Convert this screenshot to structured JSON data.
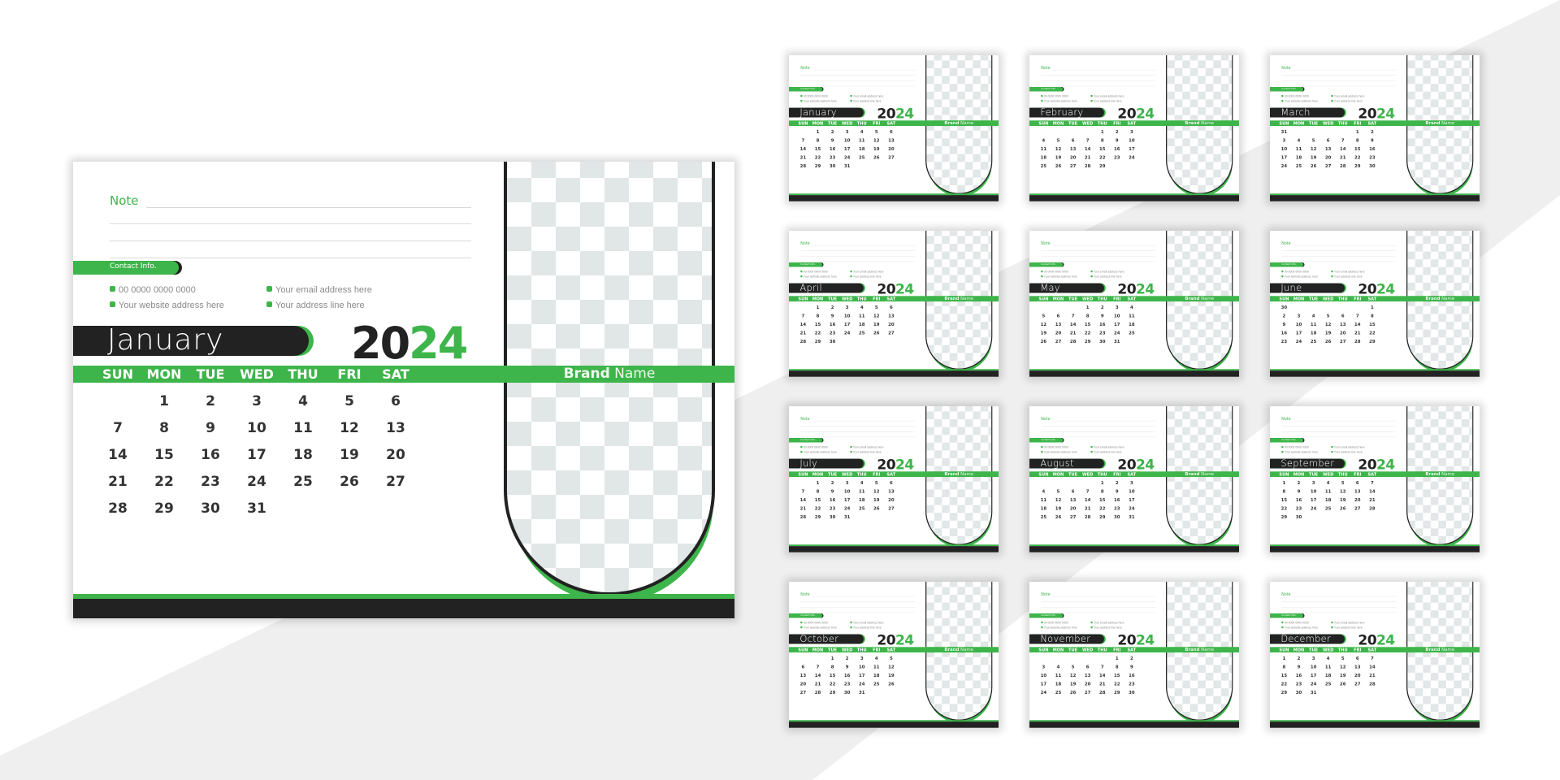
{
  "colors": {
    "accent": "#3db54a",
    "dark": "#222222",
    "checker": "#e1e6e6",
    "background_band": "#efefef"
  },
  "template": {
    "note_label": "Note",
    "contact_label": "Contact Info.",
    "phone": "00 0000 0000 0000",
    "website": "Your website address here",
    "email": "Your email address here",
    "address": "Your address line here",
    "brand_bold": "Brand",
    "brand_rest": "Name",
    "year_part1": "20",
    "year_part2": "24",
    "weekdays": [
      "SUN",
      "MON",
      "TUE",
      "WED",
      "THU",
      "FRI",
      "SAT"
    ],
    "icons": {
      "phone": "phone-icon",
      "website": "globe-icon",
      "email": "mail-icon",
      "address": "location-icon"
    }
  },
  "main_calendar": {
    "month": "January",
    "index": 0
  },
  "months": [
    {
      "name": "January",
      "start": 1,
      "days": 31
    },
    {
      "name": "February",
      "start": 4,
      "days": 29
    },
    {
      "name": "March",
      "start": 5,
      "days": 31
    },
    {
      "name": "April",
      "start": 1,
      "days": 30
    },
    {
      "name": "May",
      "start": 3,
      "days": 31
    },
    {
      "name": "June",
      "start": 6,
      "days": 30
    },
    {
      "name": "July",
      "start": 1,
      "days": 31
    },
    {
      "name": "August",
      "start": 4,
      "days": 31
    },
    {
      "name": "September",
      "start": 0,
      "days": 30
    },
    {
      "name": "October",
      "start": 2,
      "days": 31
    },
    {
      "name": "November",
      "start": 5,
      "days": 30
    },
    {
      "name": "December",
      "start": 0,
      "days": 31
    }
  ]
}
